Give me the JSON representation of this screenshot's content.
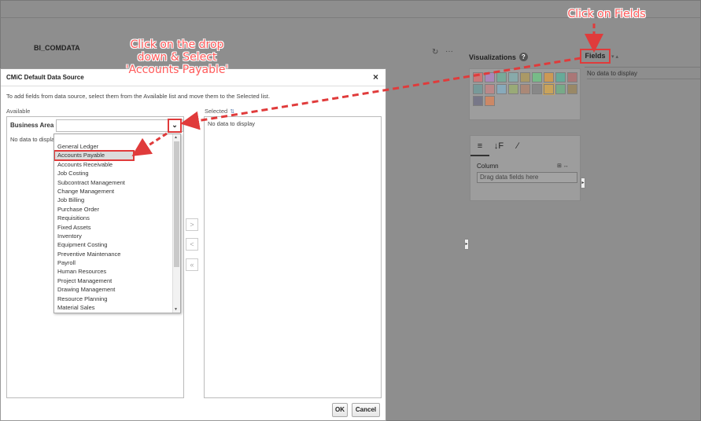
{
  "app": {
    "title": "BI_COMDATA",
    "refresh_icon": "↻",
    "more_icon": "···"
  },
  "visualizations": {
    "label": "Visualizations",
    "help_icon": "?"
  },
  "fields": {
    "label": "Fields",
    "arrows": "▾ ▴",
    "empty_text": "No data to display"
  },
  "properties": {
    "tabs": [
      "≡",
      "↓F",
      "∕"
    ],
    "column_label": "Column",
    "column_icons": "⊞ ↔",
    "drag_placeholder": "Drag data fields here"
  },
  "dialog": {
    "title": "CMiC Default Data Source",
    "close": "×",
    "description": "To add fields from data source, select them from the Available list and move them to the Selected list.",
    "available_label": "Available",
    "selected_label": "Selected",
    "selected_empty": "No data to display",
    "business_area_label": "Business Area",
    "available_empty": "No data to display",
    "ok_label": "OK",
    "cancel_label": "Cancel",
    "shuttle": [
      ">",
      "<",
      "«"
    ]
  },
  "dropdown": {
    "items": [
      "General Ledger",
      "Accounts Payable",
      "Accounts Receivable",
      "Job Costing",
      "Subcontract Management",
      "Change Management",
      "Job Billing",
      "Purchase Order",
      "Requisitions",
      "Fixed Assets",
      "Inventory",
      "Equipment Costing",
      "Preventive Maintenance",
      "Payroll",
      "Human Resources",
      "Project Management",
      "Drawing Management",
      "Resource Planning",
      "Material Sales"
    ],
    "selected": "Accounts Payable"
  },
  "annotations": {
    "fields_note": "Click on Fields",
    "dropdown_note_1": "Click on the drop",
    "dropdown_note_2": "down & Select",
    "dropdown_note_3": "'Accounts Payable'"
  },
  "colors": {
    "annotation": "#ff5a5a",
    "highlight_border": "#e03b3b"
  }
}
